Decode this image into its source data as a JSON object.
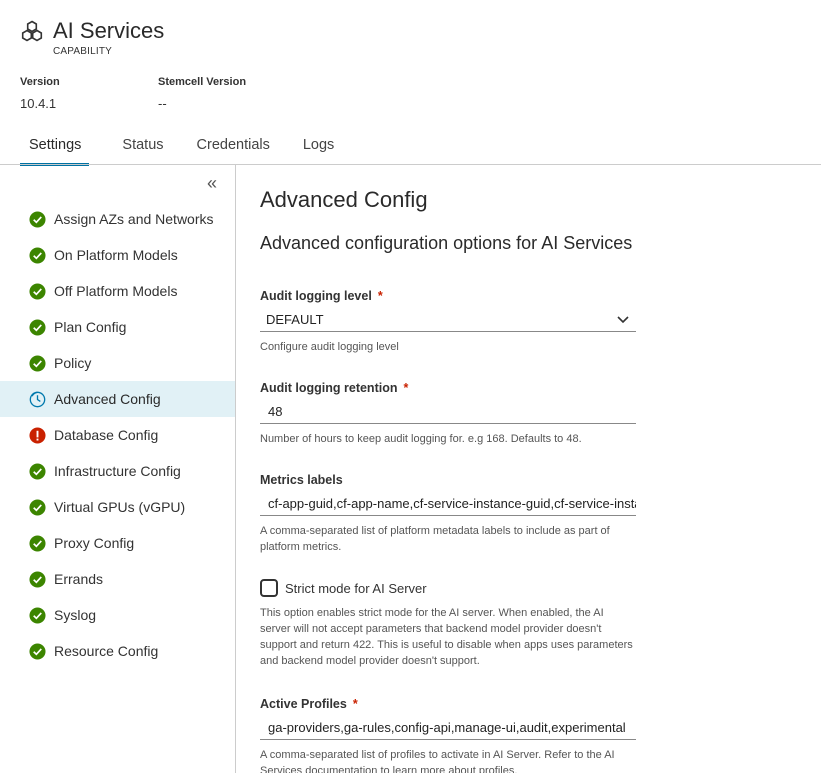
{
  "header": {
    "title": "AI Services",
    "subtitle": "CAPABILITY",
    "version_label": "Version",
    "version_value": "10.4.1",
    "stemcell_label": "Stemcell Version",
    "stemcell_value": "--"
  },
  "tabs": [
    {
      "label": "Settings",
      "active": true
    },
    {
      "label": "Status"
    },
    {
      "label": "Credentials"
    },
    {
      "label": "Logs"
    }
  ],
  "sidebar": {
    "collapse_glyph": "«",
    "items": [
      {
        "label": "Assign AZs and Networks",
        "status": "ok"
      },
      {
        "label": "On Platform Models",
        "status": "ok"
      },
      {
        "label": "Off Platform Models",
        "status": "ok"
      },
      {
        "label": "Plan Config",
        "status": "ok"
      },
      {
        "label": "Policy",
        "status": "ok"
      },
      {
        "label": "Advanced Config",
        "status": "in-progress"
      },
      {
        "label": "Database Config",
        "status": "error"
      },
      {
        "label": "Infrastructure Config",
        "status": "ok"
      },
      {
        "label": "Virtual GPUs (vGPU)",
        "status": "ok"
      },
      {
        "label": "Proxy Config",
        "status": "ok"
      },
      {
        "label": "Errands",
        "status": "ok"
      },
      {
        "label": "Syslog",
        "status": "ok"
      },
      {
        "label": "Resource Config",
        "status": "ok"
      }
    ]
  },
  "main": {
    "title": "Advanced Config",
    "subtitle": "Advanced configuration options for AI Services",
    "audit_level": {
      "label": "Audit logging level",
      "required": "*",
      "value": "DEFAULT",
      "help": "Configure audit logging level"
    },
    "audit_retention": {
      "label": "Audit logging retention",
      "required": "*",
      "value": "48",
      "help": "Number of hours to keep audit logging for. e.g 168. Defaults to 48."
    },
    "metrics_labels": {
      "label": "Metrics labels",
      "value": "cf-app-guid,cf-app-name,cf-service-instance-guid,cf-service-instance-name",
      "help": "A comma-separated list of platform metadata labels to include as part of platform metrics."
    },
    "strict_mode": {
      "label": "Strict mode for AI Server",
      "help": "This option enables strict mode for the AI server. When enabled, the AI server will not accept parameters that backend model provider doesn't support and return 422. This is useful to disable when apps uses parameters and backend model provider doesn't support."
    },
    "active_profiles": {
      "label": "Active Profiles",
      "required": "*",
      "value": "ga-providers,ga-rules,config-api,manage-ui,audit,experimental",
      "help": "A comma-separated list of profiles to activate in AI Server. Refer to the AI Services documentation to learn more about profiles."
    }
  },
  "colors": {
    "accent": "#0072a3",
    "ok": "#3c8500",
    "error": "#c92100",
    "in_progress": "#0079ad",
    "active_bg": "#e1f1f6"
  }
}
